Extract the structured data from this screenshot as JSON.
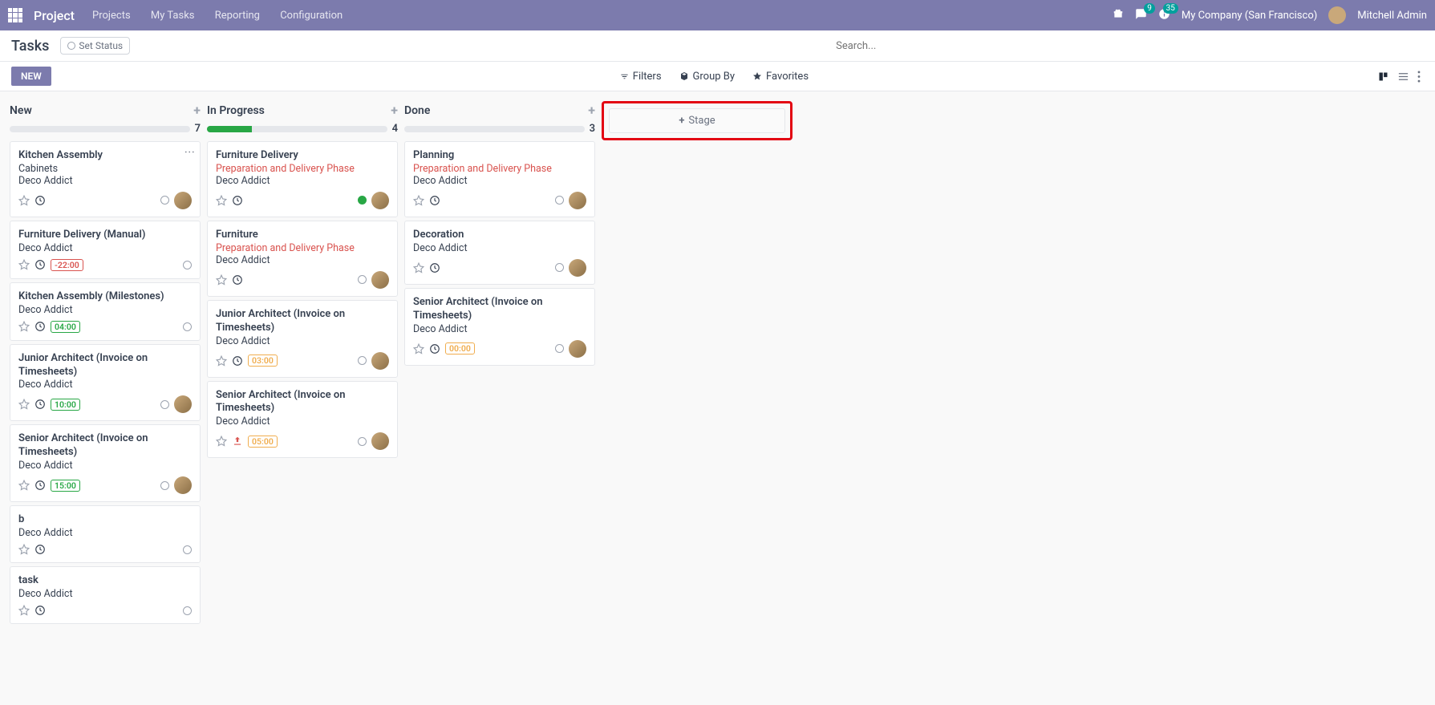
{
  "nav": {
    "brand": "Project",
    "menu": [
      "Projects",
      "My Tasks",
      "Reporting",
      "Configuration"
    ],
    "msg_badge": "9",
    "activity_badge": "35",
    "company": "My Company (San Francisco)",
    "user": "Mitchell Admin"
  },
  "subhead": {
    "title": "Tasks",
    "status_label": "Set Status",
    "search_placeholder": "Search..."
  },
  "controls": {
    "new_label": "NEW",
    "filters": "Filters",
    "groupby": "Group By",
    "favorites": "Favorites"
  },
  "add_stage_label": "Stage",
  "columns": [
    {
      "name": "New",
      "count": "7",
      "progress_pct": 0,
      "cards": [
        {
          "title": "Kitchen Assembly",
          "subtitle": "Cabinets",
          "subtitle_red": false,
          "project": "Deco Addict",
          "tag": null,
          "has_assignee": true,
          "status": "radio",
          "show_dots": true,
          "show_upload": false
        },
        {
          "title": "Furniture Delivery (Manual)",
          "subtitle": null,
          "project": "Deco Addict",
          "tag": {
            "text": "-22:00",
            "color": "red"
          },
          "has_assignee": false,
          "status": "radio",
          "show_upload": false
        },
        {
          "title": "Kitchen Assembly (Milestones)",
          "subtitle": null,
          "project": "Deco Addict",
          "tag": {
            "text": "04:00",
            "color": "green"
          },
          "has_assignee": false,
          "status": "radio",
          "show_upload": false
        },
        {
          "title": "Junior Architect (Invoice on Timesheets)",
          "subtitle": null,
          "project": "Deco Addict",
          "tag": {
            "text": "10:00",
            "color": "green"
          },
          "has_assignee": true,
          "status": "radio",
          "show_upload": false
        },
        {
          "title": "Senior Architect (Invoice on Timesheets)",
          "subtitle": null,
          "project": "Deco Addict",
          "tag": {
            "text": "15:00",
            "color": "green"
          },
          "has_assignee": true,
          "status": "radio",
          "show_upload": false
        },
        {
          "title": "b",
          "subtitle": null,
          "project": "Deco Addict",
          "tag": null,
          "has_assignee": false,
          "status": "radio",
          "show_upload": false
        },
        {
          "title": "task",
          "subtitle": null,
          "project": "Deco Addict",
          "tag": null,
          "has_assignee": false,
          "status": "radio",
          "show_upload": false
        }
      ]
    },
    {
      "name": "In Progress",
      "count": "4",
      "progress_pct": 25,
      "cards": [
        {
          "title": "Furniture Delivery",
          "subtitle": "Preparation and Delivery Phase",
          "subtitle_red": true,
          "project": "Deco Addict",
          "tag": null,
          "has_assignee": true,
          "status": "green",
          "show_upload": false
        },
        {
          "title": "Furniture",
          "subtitle": "Preparation and Delivery Phase",
          "subtitle_red": true,
          "project": "Deco Addict",
          "tag": null,
          "has_assignee": true,
          "status": "radio",
          "show_upload": false
        },
        {
          "title": "Junior Architect (Invoice on Timesheets)",
          "subtitle": null,
          "project": "Deco Addict",
          "tag": {
            "text": "03:00",
            "color": "orange"
          },
          "has_assignee": true,
          "status": "radio",
          "show_upload": false
        },
        {
          "title": "Senior Architect (Invoice on Timesheets)",
          "subtitle": null,
          "project": "Deco Addict",
          "tag": {
            "text": "05:00",
            "color": "orange"
          },
          "has_assignee": true,
          "status": "radio",
          "show_upload": true
        }
      ]
    },
    {
      "name": "Done",
      "count": "3",
      "progress_pct": 0,
      "cards": [
        {
          "title": "Planning",
          "subtitle": "Preparation and Delivery Phase",
          "subtitle_red": true,
          "project": "Deco Addict",
          "tag": null,
          "has_assignee": true,
          "status": "radio",
          "show_upload": false
        },
        {
          "title": "Decoration",
          "subtitle": null,
          "project": "Deco Addict",
          "tag": null,
          "has_assignee": true,
          "status": "radio",
          "show_upload": false
        },
        {
          "title": "Senior Architect (Invoice on Timesheets)",
          "subtitle": null,
          "project": "Deco Addict",
          "tag": {
            "text": "00:00",
            "color": "orange"
          },
          "has_assignee": true,
          "status": "radio",
          "show_upload": false
        }
      ]
    }
  ]
}
